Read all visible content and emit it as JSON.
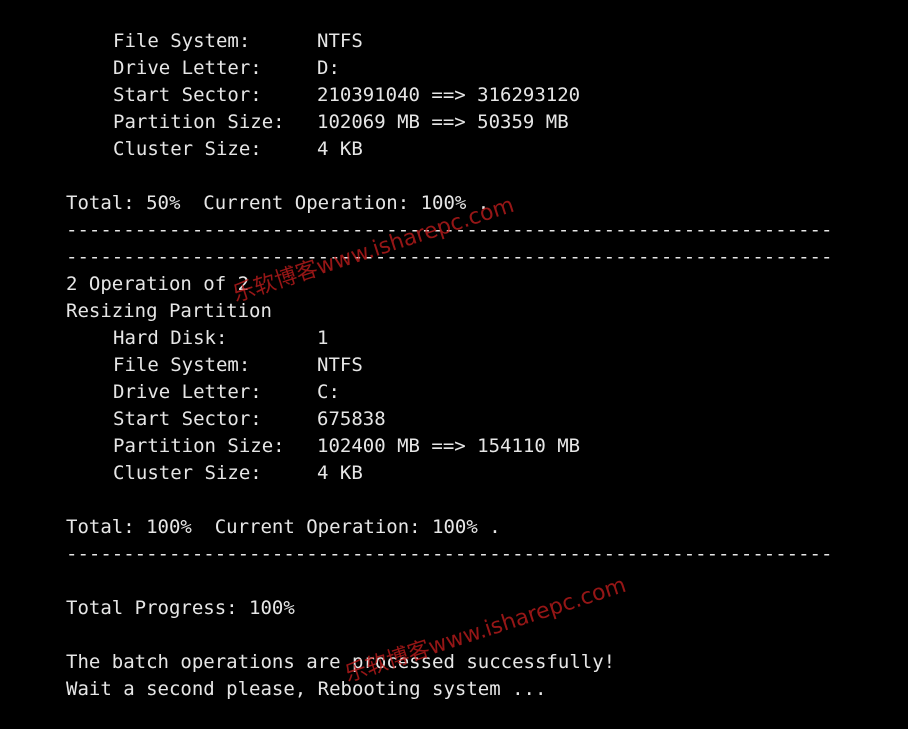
{
  "colors": {
    "background": "#000000",
    "text": "#e6e6e6",
    "watermark": "#c81e1e"
  },
  "op1": {
    "file_system_label": "File System:",
    "file_system_value": "NTFS",
    "drive_letter_label": "Drive Letter:",
    "drive_letter_value": "D:",
    "start_sector_label": "Start Sector:",
    "start_sector_value": "210391040 ==> 316293120",
    "partition_size_label": "Partition Size:",
    "partition_size_value": "102069 MB ==> 50359 MB",
    "cluster_size_label": "Cluster Size:",
    "cluster_size_value": "4 KB",
    "total_line": "Total: 50%  Current Operation: 100% ."
  },
  "divider_text": "-------------------------------------------------------------------",
  "op2": {
    "heading": "2 Operation of 2",
    "title": "Resizing Partition",
    "hard_disk_label": "Hard Disk:",
    "hard_disk_value": "1",
    "file_system_label": "File System:",
    "file_system_value": "NTFS",
    "drive_letter_label": "Drive Letter:",
    "drive_letter_value": "C:",
    "start_sector_label": "Start Sector:",
    "start_sector_value": "675838",
    "partition_size_label": "Partition Size:",
    "partition_size_value": "102400 MB ==> 154110 MB",
    "cluster_size_label": "Cluster Size:",
    "cluster_size_value": "4 KB",
    "total_line": "Total: 100%  Current Operation: 100% ."
  },
  "total_progress": "Total Progress: 100%",
  "messages": {
    "success": "The batch operations are processed successfully!",
    "rebooting": "Wait a second please, Rebooting system ..."
  },
  "watermark_text": "乐软博客www.isharepc.com"
}
